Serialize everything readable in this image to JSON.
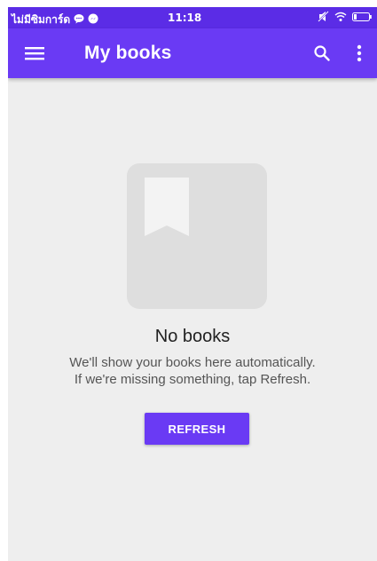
{
  "status_bar": {
    "carrier": "ไม่มีซิมการ์ด",
    "time": "11:18",
    "icons": [
      "chat-bubble-icon",
      "messenger-icon",
      "mute-icon",
      "wifi-icon",
      "battery-icon"
    ]
  },
  "app_bar": {
    "title": "My books",
    "icons": [
      "menu-icon",
      "search-icon",
      "more-vert-icon"
    ]
  },
  "empty_state": {
    "title": "No books",
    "line1": "We'll show your books here automatically.",
    "line2": "If we're missing something, tap Refresh.",
    "button_label": "REFRESH",
    "icon": "book-bookmark-icon"
  },
  "colors": {
    "status_bar": "#5b2ce6",
    "app_bar": "#6a3af4",
    "accent": "#6a3af4",
    "background": "#eeeeee",
    "illustration": "#dedede"
  }
}
